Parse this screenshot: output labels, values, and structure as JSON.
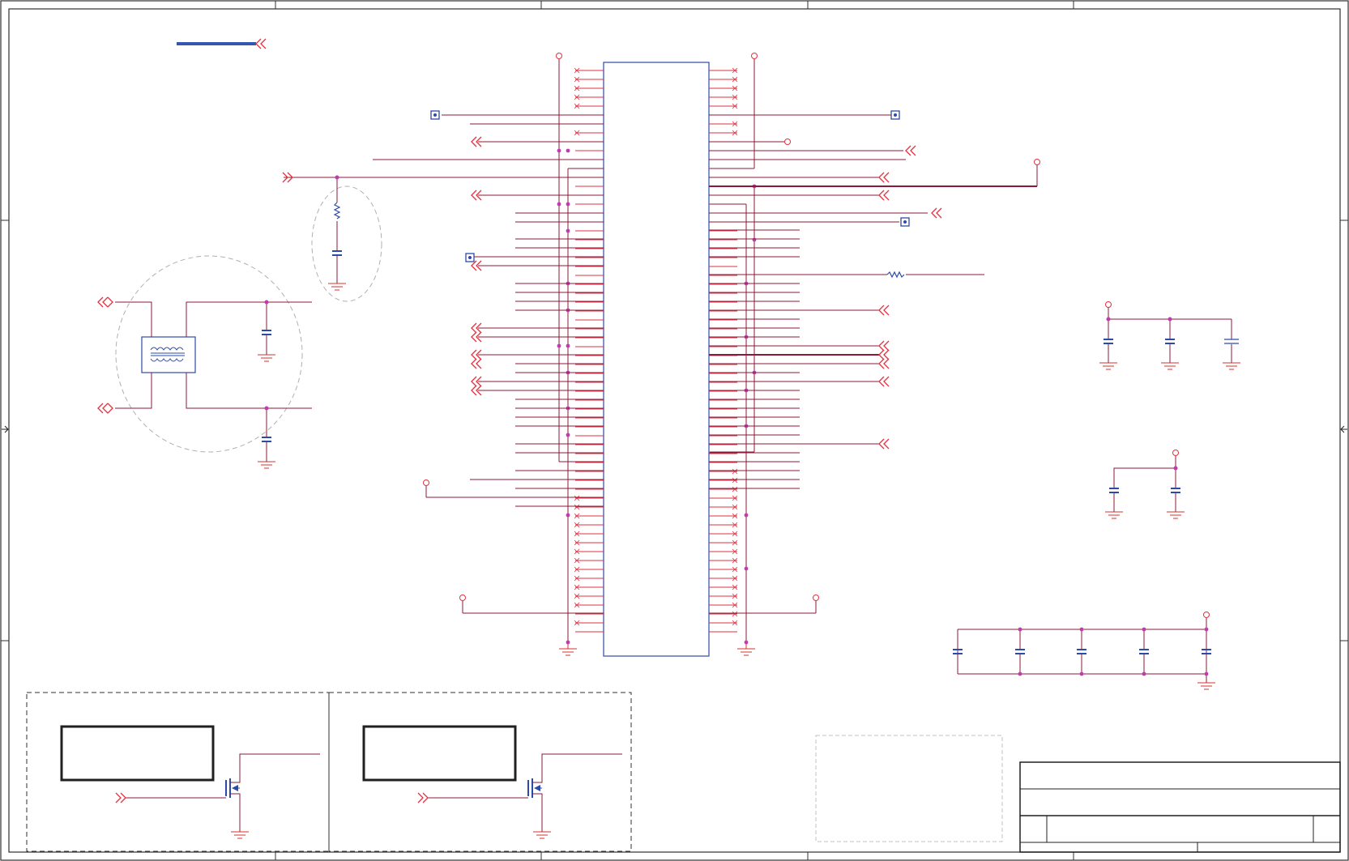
{
  "sheet": {
    "title": "",
    "title_block": {
      "company": "",
      "title": "",
      "size": "",
      "document_number": "",
      "rev": ""
    },
    "note_box": ""
  },
  "colors": {
    "wire": "#8b1a3a",
    "pin": "#e2313f",
    "junction": "#c03ab0",
    "component": "#2e4aa8",
    "ground": "#d9312f",
    "power": "#e2313f",
    "border": "#303030",
    "dashed": "#b0b0b0"
  },
  "icons": {
    "offpage_connector": "double-chevron-icon",
    "power_port": "circle-power-icon",
    "ground_symbol": "ground-icon",
    "capacitor": "capacitor-icon",
    "resistor": "resistor-icon",
    "transformer": "transformer-icon",
    "mosfet": "mosfet-icon",
    "test_point": "test-point-icon",
    "no_connect": "no-connect-icon"
  }
}
